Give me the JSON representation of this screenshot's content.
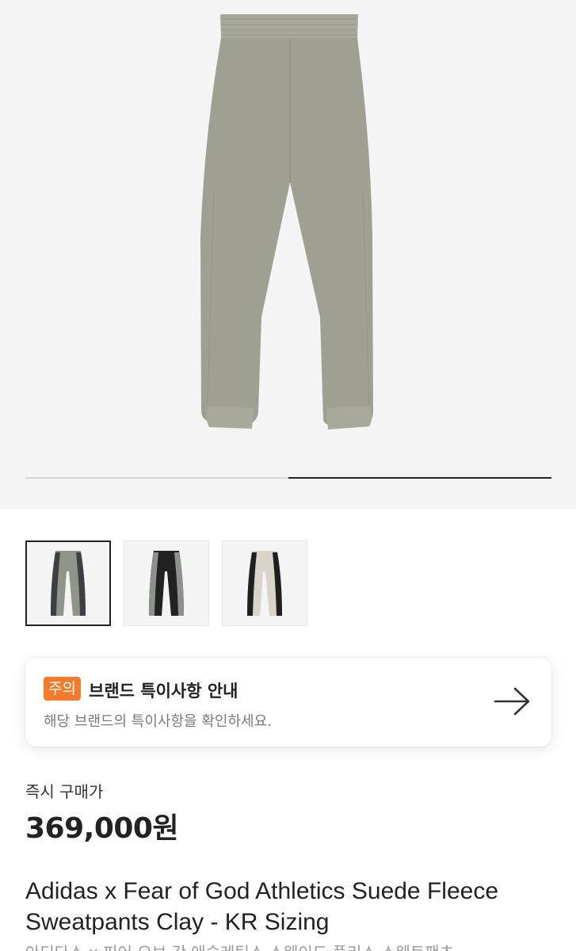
{
  "gallery": {
    "main_image": "pants-image",
    "current_slide": 2,
    "total_slides": 2,
    "thumbnails": [
      {
        "name": "clay-black-stripe-thumbnail",
        "selected": true,
        "colors": [
          "#8f9588",
          "#3c4043"
        ]
      },
      {
        "name": "black-grey-stripe-thumbnail",
        "selected": false,
        "colors": [
          "#222222",
          "#8d918b"
        ]
      },
      {
        "name": "cream-black-stripe-thumbnail",
        "selected": false,
        "colors": [
          "#d8d4c9",
          "#1f1f1f"
        ]
      }
    ]
  },
  "notice": {
    "badge": "주의",
    "title": "브랜드 특이사항 안내",
    "subtitle": "해당 브랜드의 특이사항을 확인하세요.",
    "arrow_icon": "arrow-right-icon"
  },
  "price": {
    "label": "즉시 구매가",
    "value": "369,000원"
  },
  "product": {
    "title": "Adidas x Fear of God Athletics Suede Fleece Sweatpants Clay - KR Sizing",
    "subtitle": "아디다스 x 피어 오브 갓 애슬레틱스 스웨이드 플리스 스웨트팬츠"
  },
  "colors": {
    "accent": "#f47a2e",
    "pants": "#9fa092"
  }
}
